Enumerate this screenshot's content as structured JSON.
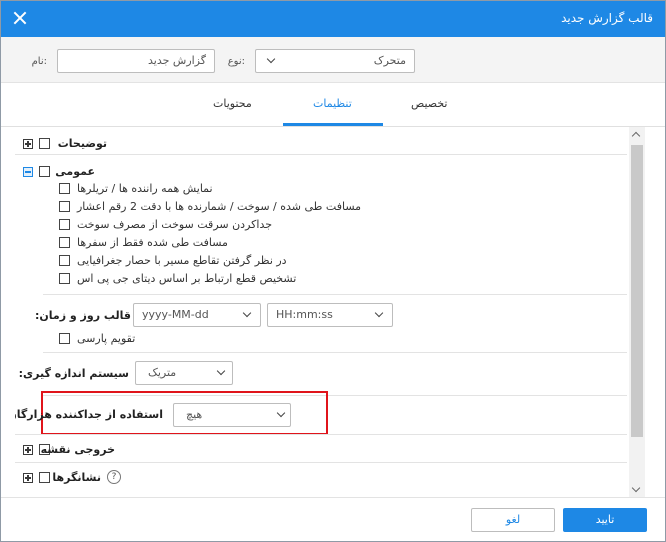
{
  "dialog": {
    "title": "قالب گزارش جدید"
  },
  "form": {
    "name_label": "نام:",
    "name_value": "گزارش جدید",
    "type_label": "نوع:",
    "type_value": "متحرک"
  },
  "tabs": [
    {
      "label": "تخصیص",
      "active": false
    },
    {
      "label": "تنظیمات",
      "active": true
    },
    {
      "label": "محتویات",
      "active": false
    }
  ],
  "sections": {
    "descriptions": {
      "label": "توضیحات"
    },
    "general": {
      "label": "عمومی",
      "options": [
        "نمایش همه راننده ها / تریلرها",
        "مسافت طی شده / سوخت / شمارنده ها با دقت 2 رقم اعشار",
        "جداکردن سرقت سوخت از مصرف سوخت",
        "مسافت طی شده فقط از سفرها",
        "در نظر گرفتن تقاطع مسیر با حصار جغرافیایی",
        "تشخیص قطع ارتباط بر اساس دیتای جی پی اس"
      ],
      "datetime_label": "قالب روز و زمان:",
      "date_format": "yyyy-MM-dd",
      "time_format": "HH:mm:ss",
      "persian_calendar_label": "تقویم پارسی",
      "measurement_label": "سیستم اندازه گیری:",
      "measurement_value": "متریک",
      "separator_label": "استفاده از جداکننده هزارگان:",
      "separator_value": "هیچ"
    },
    "map_output": {
      "label": "خروجی نقشه"
    },
    "markers": {
      "label": "نشانگرها",
      "help": "?"
    }
  },
  "footer": {
    "ok_label": "تایید",
    "cancel_label": "لغو"
  },
  "colors": {
    "accent": "#1e88e5",
    "highlight": "#e0141b"
  }
}
